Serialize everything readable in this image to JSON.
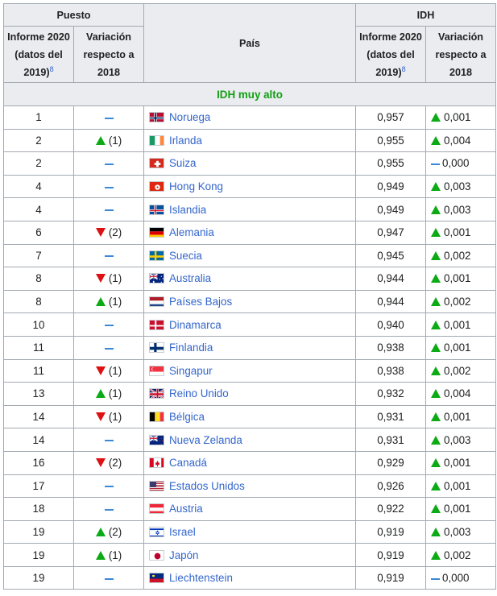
{
  "headers": {
    "puesto": "Puesto",
    "idh": "IDH",
    "pais": "País",
    "informe_line1": "Informe 2020",
    "informe_line2": "(datos del",
    "informe_line3": "2019)",
    "ref": "8",
    "variacion_line1": "Variación",
    "variacion_line2": "respecto a",
    "variacion_line3": "2018"
  },
  "section": "IDH muy alto",
  "colors": {
    "up": "#0caa14",
    "down": "#dd1111",
    "nochange": "#3a88d8",
    "link": "#3366cc",
    "section": "#14a014"
  },
  "rows": [
    {
      "rank": "1",
      "rank_change": "none",
      "rank_delta": "",
      "country": "Noruega",
      "flag": "flag-norway",
      "idh": "0,957",
      "idh_change": "up",
      "idh_delta": "0,001"
    },
    {
      "rank": "2",
      "rank_change": "up",
      "rank_delta": "(1)",
      "country": "Irlanda",
      "flag": "flag-ireland",
      "idh": "0,955",
      "idh_change": "up",
      "idh_delta": "0,004"
    },
    {
      "rank": "2",
      "rank_change": "none",
      "rank_delta": "",
      "country": "Suiza",
      "flag": "flag-switzerland",
      "idh": "0,955",
      "idh_change": "none",
      "idh_delta": "0,000"
    },
    {
      "rank": "4",
      "rank_change": "none",
      "rank_delta": "",
      "country": "Hong Kong",
      "flag": "flag-hong-kong",
      "idh": "0,949",
      "idh_change": "up",
      "idh_delta": "0,003"
    },
    {
      "rank": "4",
      "rank_change": "none",
      "rank_delta": "",
      "country": "Islandia",
      "flag": "flag-iceland",
      "idh": "0,949",
      "idh_change": "up",
      "idh_delta": "0,003"
    },
    {
      "rank": "6",
      "rank_change": "down",
      "rank_delta": "(2)",
      "country": "Alemania",
      "flag": "flag-germany",
      "idh": "0,947",
      "idh_change": "up",
      "idh_delta": "0,001"
    },
    {
      "rank": "7",
      "rank_change": "none",
      "rank_delta": "",
      "country": "Suecia",
      "flag": "flag-sweden",
      "idh": "0,945",
      "idh_change": "up",
      "idh_delta": "0,002"
    },
    {
      "rank": "8",
      "rank_change": "down",
      "rank_delta": "(1)",
      "country": "Australia",
      "flag": "flag-australia",
      "idh": "0,944",
      "idh_change": "up",
      "idh_delta": "0,001"
    },
    {
      "rank": "8",
      "rank_change": "up",
      "rank_delta": "(1)",
      "country": "Países Bajos",
      "flag": "flag-netherlands",
      "idh": "0,944",
      "idh_change": "up",
      "idh_delta": "0,002"
    },
    {
      "rank": "10",
      "rank_change": "none",
      "rank_delta": "",
      "country": "Dinamarca",
      "flag": "flag-denmark",
      "idh": "0,940",
      "idh_change": "up",
      "idh_delta": "0,001"
    },
    {
      "rank": "11",
      "rank_change": "none",
      "rank_delta": "",
      "country": "Finlandia",
      "flag": "flag-finland",
      "idh": "0,938",
      "idh_change": "up",
      "idh_delta": "0,001"
    },
    {
      "rank": "11",
      "rank_change": "down",
      "rank_delta": "(1)",
      "country": "Singapur",
      "flag": "flag-singapore",
      "idh": "0,938",
      "idh_change": "up",
      "idh_delta": "0,002"
    },
    {
      "rank": "13",
      "rank_change": "up",
      "rank_delta": "(1)",
      "country": "Reino Unido",
      "flag": "flag-united-kingdom",
      "idh": "0,932",
      "idh_change": "up",
      "idh_delta": "0,004"
    },
    {
      "rank": "14",
      "rank_change": "down",
      "rank_delta": "(1)",
      "country": "Bélgica",
      "flag": "flag-belgium",
      "idh": "0,931",
      "idh_change": "up",
      "idh_delta": "0,001"
    },
    {
      "rank": "14",
      "rank_change": "none",
      "rank_delta": "",
      "country": "Nueva Zelanda",
      "flag": "flag-new-zealand",
      "idh": "0,931",
      "idh_change": "up",
      "idh_delta": "0,003"
    },
    {
      "rank": "16",
      "rank_change": "down",
      "rank_delta": "(2)",
      "country": "Canadá",
      "flag": "flag-canada",
      "idh": "0,929",
      "idh_change": "up",
      "idh_delta": "0,001"
    },
    {
      "rank": "17",
      "rank_change": "none",
      "rank_delta": "",
      "country": "Estados Unidos",
      "flag": "flag-united-states",
      "idh": "0,926",
      "idh_change": "up",
      "idh_delta": "0,001"
    },
    {
      "rank": "18",
      "rank_change": "none",
      "rank_delta": "",
      "country": "Austria",
      "flag": "flag-austria",
      "idh": "0,922",
      "idh_change": "up",
      "idh_delta": "0,001"
    },
    {
      "rank": "19",
      "rank_change": "up",
      "rank_delta": "(2)",
      "country": "Israel",
      "flag": "flag-israel",
      "idh": "0,919",
      "idh_change": "up",
      "idh_delta": "0,003"
    },
    {
      "rank": "19",
      "rank_change": "up",
      "rank_delta": "(1)",
      "country": "Japón",
      "flag": "flag-japan",
      "idh": "0,919",
      "idh_change": "up",
      "idh_delta": "0,002"
    },
    {
      "rank": "19",
      "rank_change": "none",
      "rank_delta": "",
      "country": "Liechtenstein",
      "flag": "flag-liechtenstein",
      "idh": "0,919",
      "idh_change": "none",
      "idh_delta": "0,000"
    }
  ]
}
